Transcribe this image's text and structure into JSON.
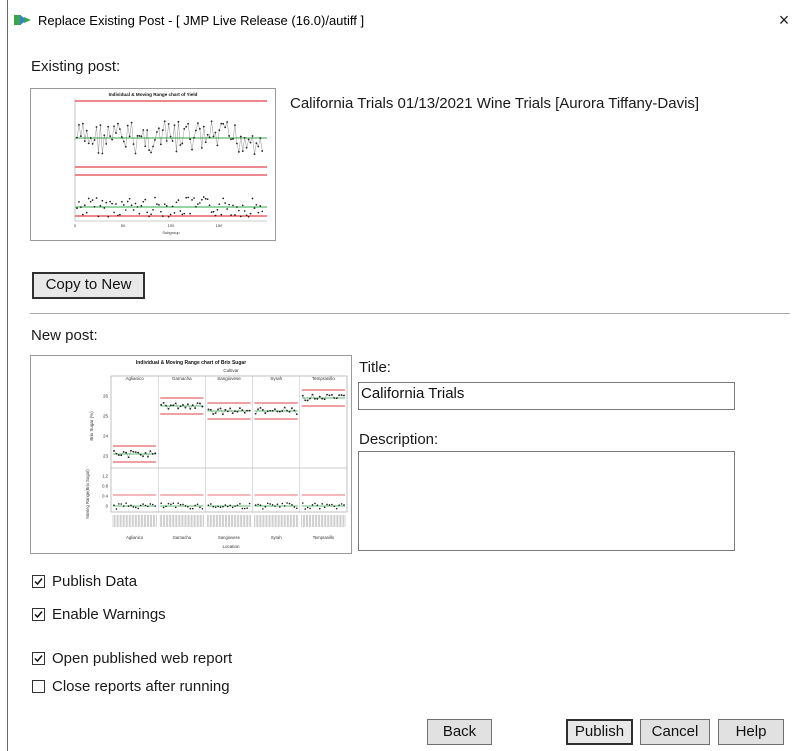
{
  "window": {
    "title": "Replace Existing Post - [ JMP Live Release (16.0)/autiff ]",
    "close_glyph": "×",
    "icon": "jmp-live-arrow-icon"
  },
  "existing": {
    "label": "Existing post:",
    "thumb_title": "Individual & Moving Range chart of Yield",
    "info": "California Trials  01/13/2021  Wine Trials [Aurora Tiffany-Davis]",
    "copy_button": "Copy to New"
  },
  "new_post": {
    "label": "New post:",
    "thumb": {
      "title": "Individual & Moving Range chart of Brix Sugar",
      "group_header": "Cultivar",
      "groups": [
        "Aglianico",
        "Garnacha",
        "Sangiovese",
        "Syrah",
        "Tempranillo"
      ],
      "y_ticks_top": [
        "26",
        "25",
        "24",
        "23"
      ],
      "y_ticks_bottom": [
        "1.2",
        "0.8",
        "0.4",
        "0"
      ],
      "ylabel_top": "Brix Sugar (%)",
      "ylabel_bottom": "Moving Range(Brix Sugar)",
      "xlabel": "Location"
    },
    "title_label": "Title:",
    "title_value": "California Trials",
    "description_label": "Description:",
    "description_value": ""
  },
  "options": {
    "publish_data": {
      "label": "Publish Data",
      "checked": true
    },
    "enable_warnings": {
      "label": "Enable Warnings",
      "checked": true
    },
    "open_report": {
      "label": "Open published web report",
      "checked": true
    },
    "close_reports": {
      "label": "Close reports after running",
      "checked": false
    }
  },
  "buttons": {
    "back": "Back",
    "publish": "Publish",
    "cancel": "Cancel",
    "help": "Help"
  },
  "colors": {
    "limit_red": "#e0404a",
    "center_green": "#2ea84a",
    "point": "#1a1a1a",
    "accent_green": "#3aa64c",
    "accent_blue": "#3a7bd5"
  }
}
